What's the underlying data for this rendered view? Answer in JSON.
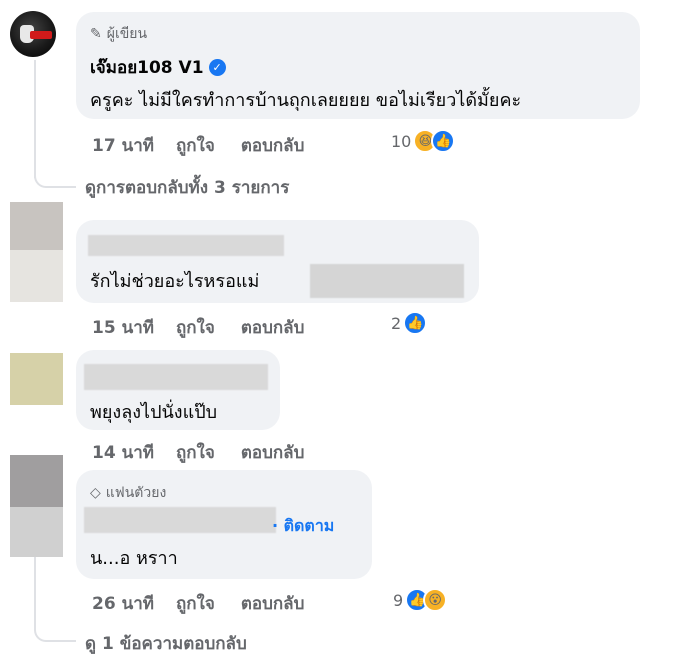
{
  "comments": [
    {
      "badge": "ผู้เขียน",
      "author": "เจ๊มอย108 V1",
      "text": "ครูคะ ไม่มีใครทำการบ้านถุกเลยยยย ขอไม่เรียวได้มั้ยคะ",
      "time": "17 นาที",
      "like_label": "ถูกใจ",
      "reply_label": "ตอบกลับ",
      "react_count": "10",
      "reactions": [
        "haha",
        "like"
      ]
    },
    {
      "text": "รักไม่ช่วยอะไรหรอแม่",
      "time": "15 นาที",
      "like_label": "ถูกใจ",
      "reply_label": "ตอบกลับ",
      "react_count": "2",
      "reactions": [
        "like"
      ]
    },
    {
      "text": "พยุงลุงไปนั่งแป๊บ",
      "time": "14 นาที",
      "like_label": "ถูกใจ",
      "reply_label": "ตอบกลับ"
    },
    {
      "badge": "แฟนตัวยง",
      "follow_label": "· ติดตาม",
      "text": "น...อ หราา",
      "time": "26 นาที",
      "like_label": "ถูกใจ",
      "reply_label": "ตอบกลับ",
      "react_count": "9",
      "reactions": [
        "like",
        "wow"
      ]
    }
  ],
  "view_replies_1": "ดูการตอบกลับทั้ง 3 รายการ",
  "view_replies_2": "ดู 1 ข้อความตอบกลับ",
  "colors": {
    "accent": "#1877f2",
    "bubble": "#f0f2f5",
    "meta": "#65676b"
  },
  "icons": [
    "pencil-icon",
    "verified-icon",
    "diamond-icon",
    "like-icon",
    "haha-icon",
    "wow-icon"
  ]
}
